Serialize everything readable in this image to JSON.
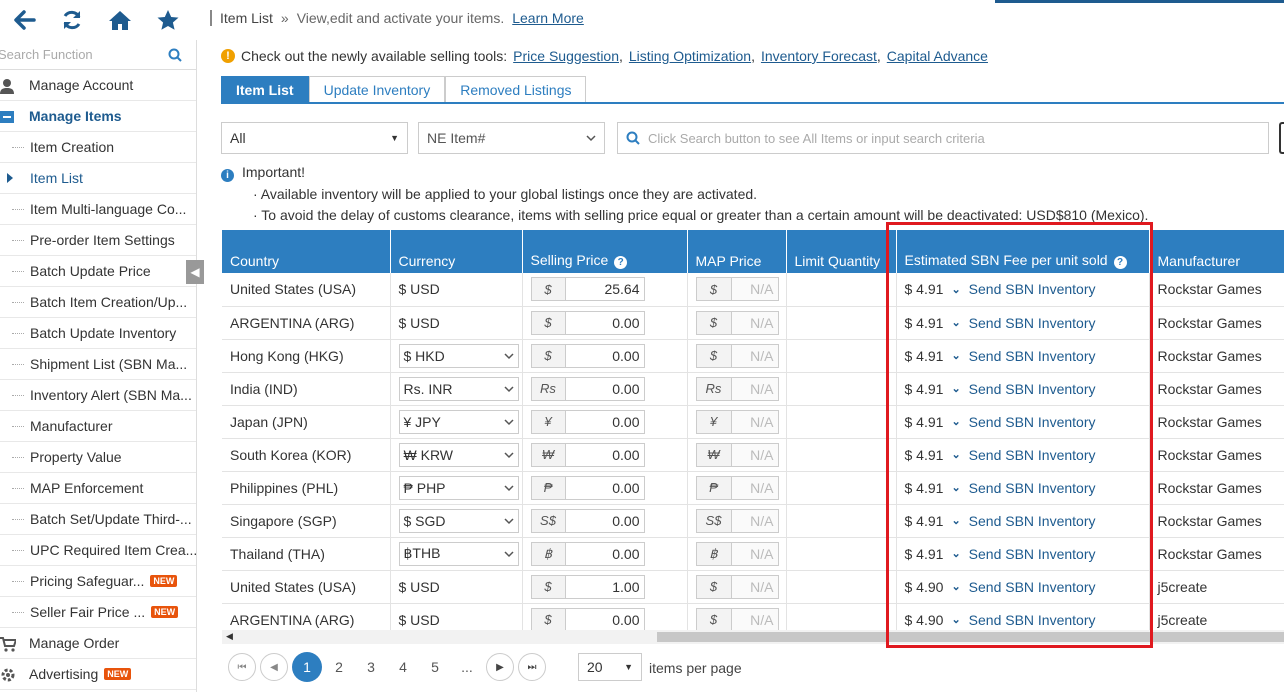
{
  "topbar": {
    "buttons": [
      "back-icon",
      "refresh-icon",
      "home-icon",
      "star-icon"
    ]
  },
  "sidebar": {
    "search_placeholder": "Search Function",
    "manage_account": "Manage Account",
    "manage_items": "Manage Items",
    "items": [
      {
        "label": "Item Creation"
      },
      {
        "label": "Item List",
        "current": true
      },
      {
        "label": "Item Multi-language Co..."
      },
      {
        "label": "Pre-order Item Settings"
      },
      {
        "label": "Batch Update Price"
      },
      {
        "label": "Batch Item Creation/Up..."
      },
      {
        "label": "Batch Update Inventory"
      },
      {
        "label": "Shipment List (SBN Ma..."
      },
      {
        "label": "Inventory Alert (SBN Ma..."
      },
      {
        "label": "Manufacturer"
      },
      {
        "label": "Property Value"
      },
      {
        "label": "MAP Enforcement"
      },
      {
        "label": "Batch Set/Update Third-..."
      },
      {
        "label": "UPC Required Item Crea..."
      },
      {
        "label": "Pricing Safeguar...",
        "badge": "NEW"
      },
      {
        "label": "Seller Fair Price ...",
        "badge": "NEW"
      }
    ],
    "manage_order": "Manage Order",
    "advertising": "Advertising",
    "advertising_badge": "NEW"
  },
  "breadcrumb": {
    "title": "Item List",
    "sep": "»",
    "desc": "View,edit and activate your items.",
    "learn_more": "Learn More"
  },
  "notice": {
    "text": "Check out the newly available selling tools:",
    "links": [
      "Price Suggestion",
      "Listing Optimization",
      "Inventory Forecast",
      "Capital Advance"
    ]
  },
  "tabs": [
    "Item List",
    "Update Inventory",
    "Removed Listings"
  ],
  "filters": {
    "scope": "All",
    "field": "NE Item#",
    "search_placeholder": "Click Search button to see All Items or input search criteria"
  },
  "important": {
    "title": "Important!",
    "lines": [
      "· Available inventory will be applied to your global listings once they are activated.",
      "· To avoid the delay of customs clearance, items with selling price equal or greater than a certain amount will be deactivated: USD$810 (Mexico)."
    ]
  },
  "table": {
    "headers": [
      "Country",
      "Currency",
      "Selling Price",
      "MAP Price",
      "Limit Quantity",
      "Estimated SBN Fee per unit sold",
      "Manufacturer"
    ],
    "map_placeholder": "N/A",
    "sbn_link": "Send SBN Inventory",
    "rows": [
      {
        "country": "United States (USA)",
        "currency": "$ USD",
        "dropdown": false,
        "sym": "$",
        "price": "25.64",
        "fee": "$ 4.91",
        "mfr": "Rockstar Games"
      },
      {
        "country": "ARGENTINA (ARG)",
        "currency": "$ USD",
        "dropdown": false,
        "sym": "$",
        "price": "0.00",
        "fee": "$ 4.91",
        "mfr": "Rockstar Games"
      },
      {
        "country": "Hong Kong (HKG)",
        "currency": "$ HKD",
        "dropdown": true,
        "sym": "$",
        "price": "0.00",
        "fee": "$ 4.91",
        "mfr": "Rockstar Games"
      },
      {
        "country": "India (IND)",
        "currency": "Rs. INR",
        "dropdown": true,
        "sym": "Rs",
        "price": "0.00",
        "fee": "$ 4.91",
        "mfr": "Rockstar Games"
      },
      {
        "country": "Japan (JPN)",
        "currency": "¥ JPY",
        "dropdown": true,
        "sym": "¥",
        "price": "0.00",
        "fee": "$ 4.91",
        "mfr": "Rockstar Games"
      },
      {
        "country": "South Korea (KOR)",
        "currency": "₩ KRW",
        "dropdown": true,
        "sym": "₩",
        "price": "0.00",
        "fee": "$ 4.91",
        "mfr": "Rockstar Games"
      },
      {
        "country": "Philippines (PHL)",
        "currency": "₱ PHP",
        "dropdown": true,
        "sym": "₱",
        "price": "0.00",
        "fee": "$ 4.91",
        "mfr": "Rockstar Games"
      },
      {
        "country": "Singapore (SGP)",
        "currency": "$ SGD",
        "dropdown": true,
        "sym": "S$",
        "price": "0.00",
        "fee": "$ 4.91",
        "mfr": "Rockstar Games"
      },
      {
        "country": "Thailand (THA)",
        "currency": "฿THB",
        "dropdown": true,
        "sym": "฿",
        "price": "0.00",
        "fee": "$ 4.91",
        "mfr": "Rockstar Games"
      },
      {
        "country": "United States (USA)",
        "currency": "$ USD",
        "dropdown": false,
        "sym": "$",
        "price": "1.00",
        "fee": "$ 4.90",
        "mfr": "j5create"
      },
      {
        "country": "ARGENTINA (ARG)",
        "currency": "$ USD",
        "dropdown": false,
        "sym": "$",
        "price": "0.00",
        "fee": "$ 4.90",
        "mfr": "j5create"
      }
    ]
  },
  "pagination": {
    "pages": [
      "1",
      "2",
      "3",
      "4",
      "5",
      "..."
    ],
    "current": "1",
    "page_size": "20",
    "per_page_label": "items per page"
  },
  "colors": {
    "primary": "#2d7ec0",
    "highlight": "#e0191f",
    "badge": "#e8540c"
  }
}
